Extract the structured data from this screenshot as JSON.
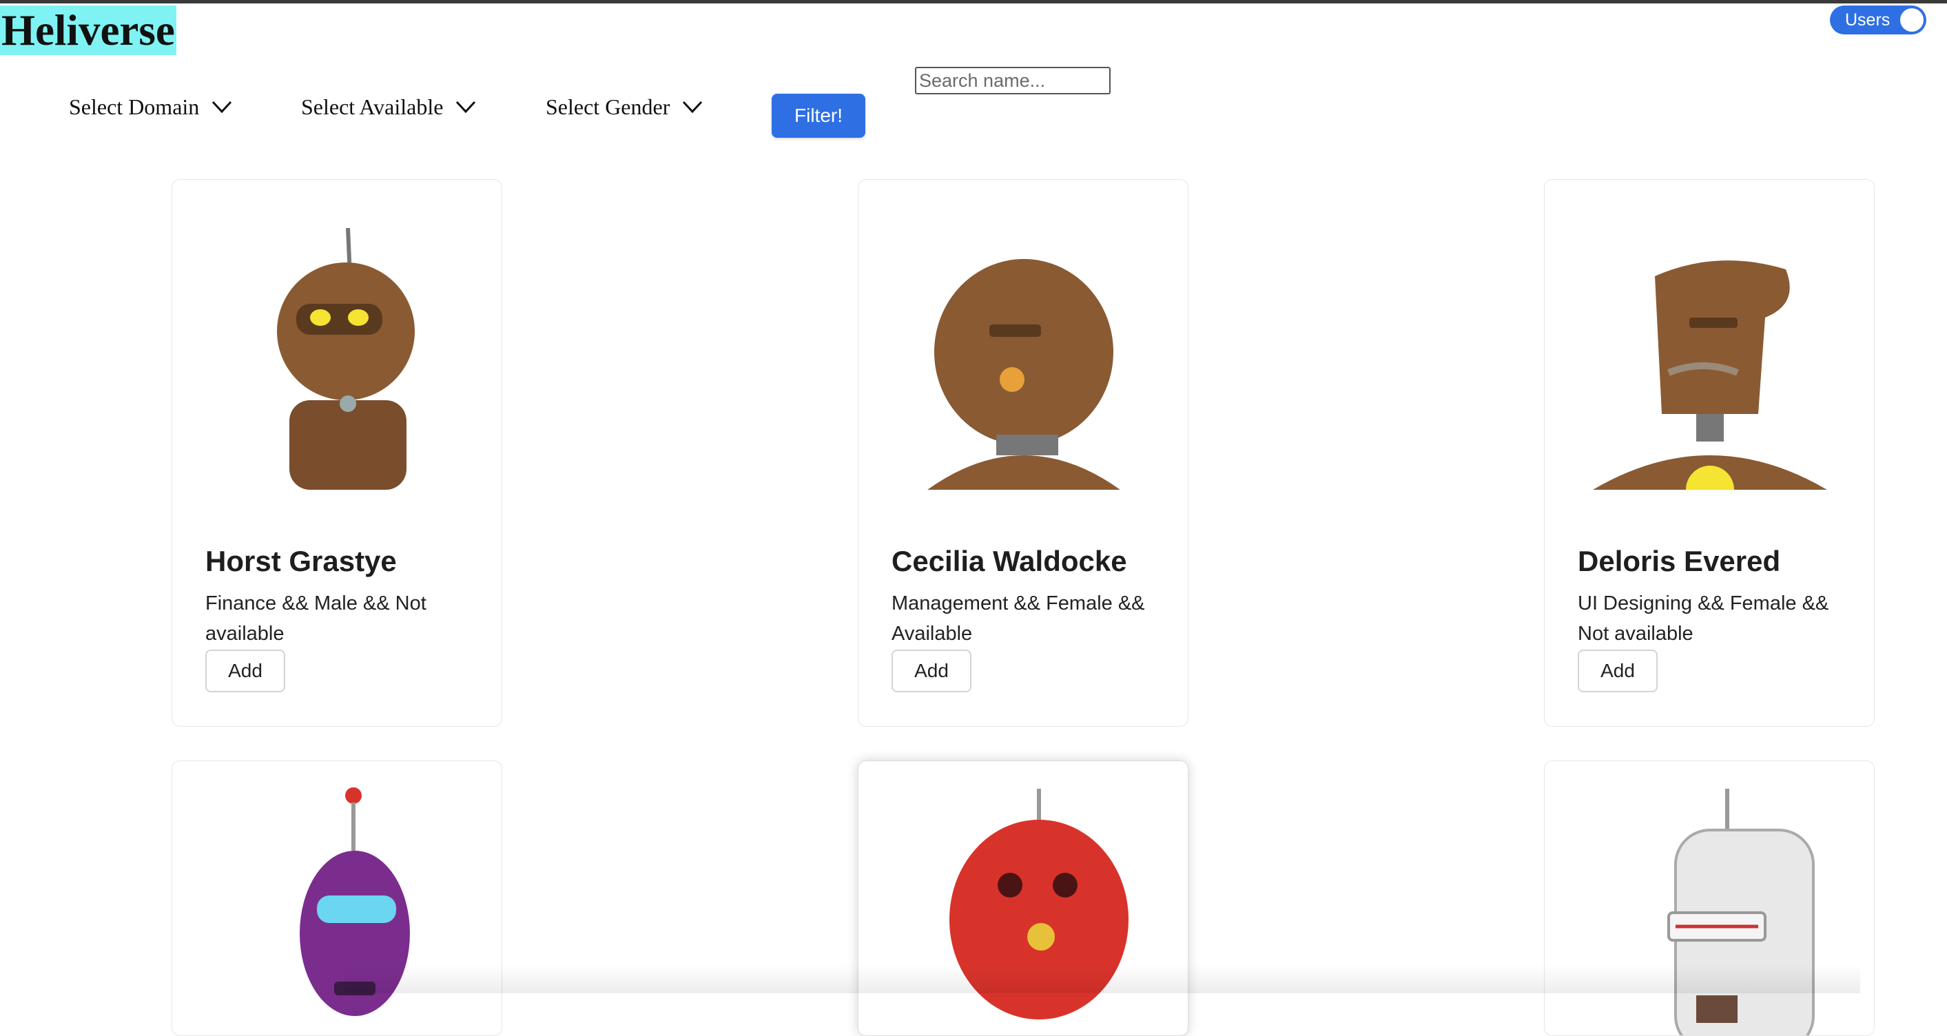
{
  "app": {
    "title": "Heliverse"
  },
  "toggle": {
    "label": "Users"
  },
  "filters": {
    "domain_label": "Select Domain",
    "available_label": "Select Available",
    "gender_label": "Select Gender",
    "filter_button": "Filter!",
    "search_placeholder": "Search name..."
  },
  "users": [
    {
      "name": "Horst Grastye",
      "description": "Finance && Male && Not available",
      "action": "Add",
      "avatar_icon": "robot-avatar-icon",
      "avatar_color": "#8a5a33"
    },
    {
      "name": "Cecilia Waldocke",
      "description": "Management && Female && Available",
      "action": "Add",
      "avatar_icon": "robot-avatar-icon",
      "avatar_color": "#8a5a33"
    },
    {
      "name": "Deloris Evered",
      "description": "UI Designing && Female && Not available",
      "action": "Add",
      "avatar_icon": "robot-avatar-icon",
      "avatar_color": "#8a5a33"
    },
    {
      "avatar_icon": "robot-avatar-icon",
      "avatar_color": "#7b2d8e"
    },
    {
      "avatar_icon": "robot-avatar-icon",
      "avatar_color": "#d8332b"
    },
    {
      "avatar_icon": "robot-avatar-icon",
      "avatar_color": "#e8e8e8"
    }
  ]
}
